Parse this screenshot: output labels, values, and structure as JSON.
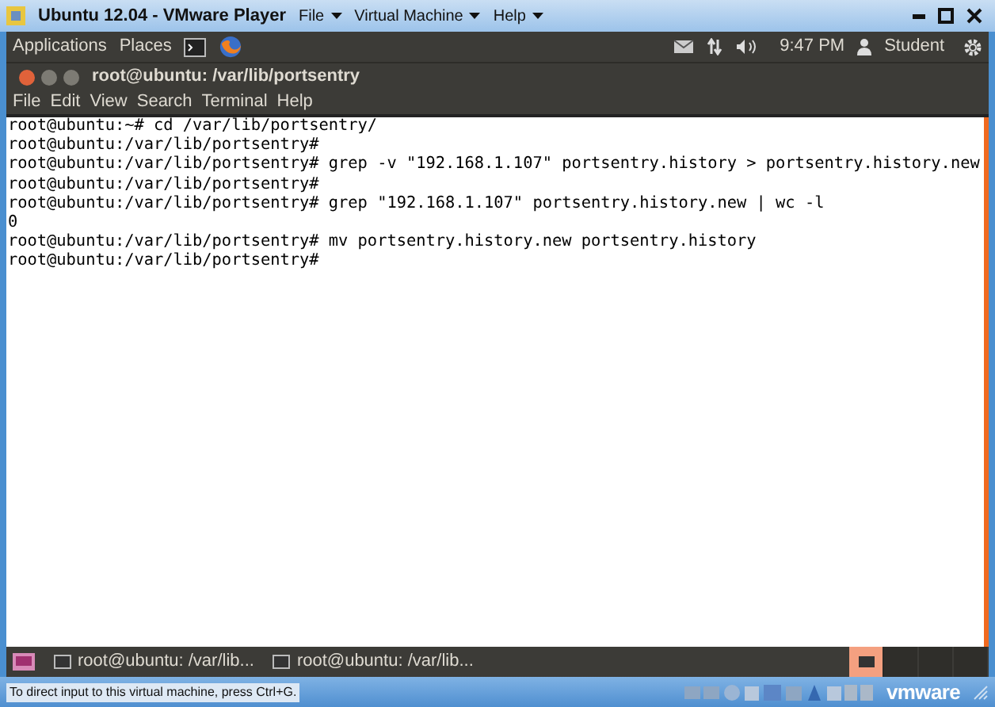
{
  "window": {
    "title": "Ubuntu 12.04 - VMware Player",
    "menus": [
      "File",
      "Virtual Machine",
      "Help"
    ]
  },
  "top_panel": {
    "menus": [
      "Applications",
      "Places"
    ],
    "clock": "9:47 PM",
    "user": "Student"
  },
  "terminal": {
    "title": "root@ubuntu: /var/lib/portsentry",
    "menus": [
      "File",
      "Edit",
      "View",
      "Search",
      "Terminal",
      "Help"
    ],
    "lines": [
      "root@ubuntu:~# cd /var/lib/portsentry/",
      "root@ubuntu:/var/lib/portsentry#",
      "root@ubuntu:/var/lib/portsentry# grep -v \"192.168.1.107\" portsentry.history > portsentry.history.new",
      "root@ubuntu:/var/lib/portsentry#",
      "root@ubuntu:/var/lib/portsentry# grep \"192.168.1.107\" portsentry.history.new | wc -l",
      "0",
      "root@ubuntu:/var/lib/portsentry# mv portsentry.history.new portsentry.history",
      "root@ubuntu:/var/lib/portsentry#"
    ]
  },
  "taskbar": {
    "items": [
      {
        "label": "root@ubuntu: /var/lib..."
      },
      {
        "label": "root@ubuntu: /var/lib..."
      }
    ],
    "workspaces": [
      {
        "selected": true
      },
      {
        "selected": false
      },
      {
        "selected": false
      },
      {
        "selected": false
      }
    ]
  },
  "status_bar": {
    "hint": "To direct input to this virtual machine, press Ctrl+G.",
    "brand": "vmware"
  }
}
